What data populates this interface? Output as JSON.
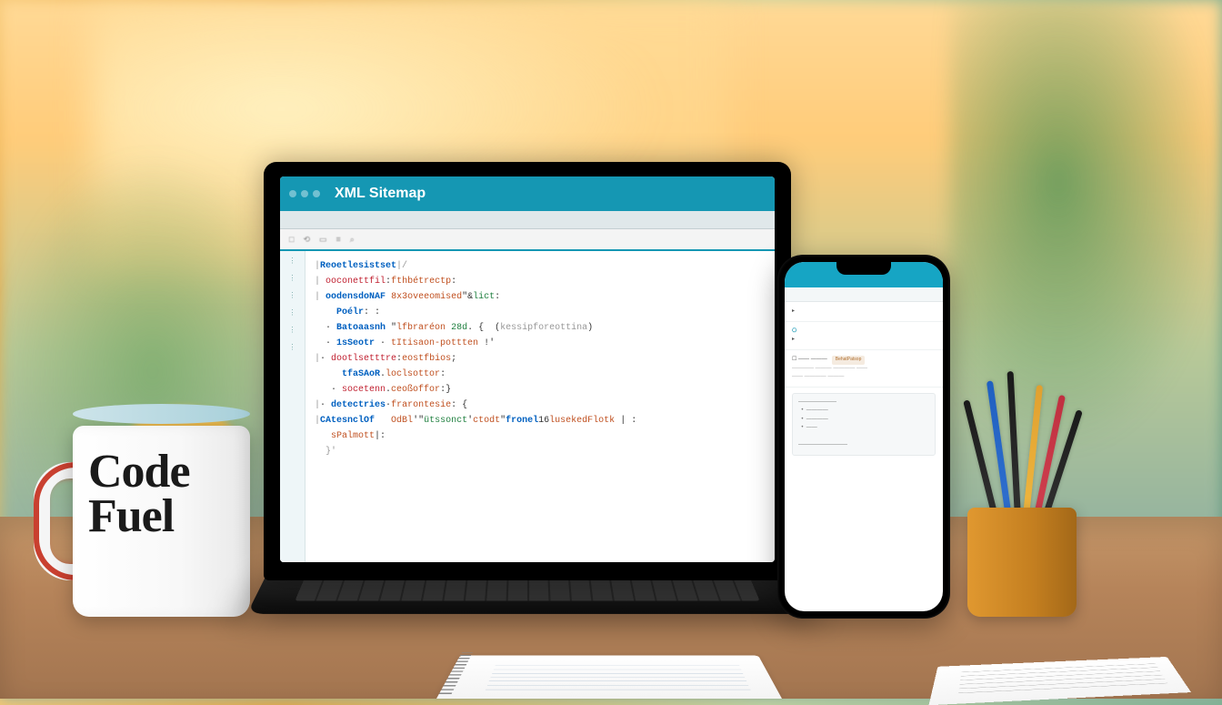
{
  "mug": {
    "line1": "Code",
    "line2": "Fuel"
  },
  "laptop": {
    "title": "XML Sitemap",
    "toolbar_hints": [
      "□",
      "⟲",
      "▭",
      "≡",
      "⌕"
    ],
    "code_lines": [
      "<span class='com'>|</span><span class='kw'>Reoetlesistset</span><span class='com'>|/</span>",
      "<span class='com'>|</span> <span class='red'>ooconettfil</span>:<span class='fn'>fthbétrectp</span>:",
      "<span class='com'>|</span> <span class='kw'>oodensdoNAF</span> <span class='fn'>8x3oveeomised</span>\"&<span class='lit'>lict</span>:",
      "    <span class='kw'>Poélr</span>: :",
      "  · <span class='kw'>Batoaasnh</span> \"<span class='fn'>lfbraréon</span> <span class='lit'>28d</span>. {  (<span class='com'>kessipforeottina</span>)",
      "  · <span class='kw'>1sSeotr</span> · <span class='fn'>tItisaon-pottten</span> !'",
      "<span class='com'>|</span>· <span class='red'>dootlsetttre</span>:<span class='fn'>eostfbios</span>;",
      "     <span class='kw'>tfaSAoR</span>.<span class='fn'>loclsottor</span>:",
      "   · <span class='red'>socetenn</span>.<span class='fn'>ceoßoffor</span>:}",
      "<span class='com'>|</span>· <span class='kw'>detectries</span>·<span class='fn'>frarontesie</span>: {",
      "<span class='com'>|</span><span class='kw'>CAtesnclOf</span>   <span class='fn'>OdBl</span>'\"<span class='lit'>ütssonct</span>'<span class='fn'>ctodt</span>\"<span class='kw'>fronel</span>16<span class='fn'>lusekedFlotk</span> | :",
      "   <span class='fn'>sPalmott</span>|:",
      "  <span class='com'>}'</span>"
    ]
  },
  "phone": {
    "nav_items": [
      "",
      ""
    ],
    "row1_label": "",
    "row2_label": "",
    "row2_highlight": "",
    "row3_label": "BehatPatsop",
    "box_lines": [
      "",
      "",
      "",
      ""
    ]
  }
}
